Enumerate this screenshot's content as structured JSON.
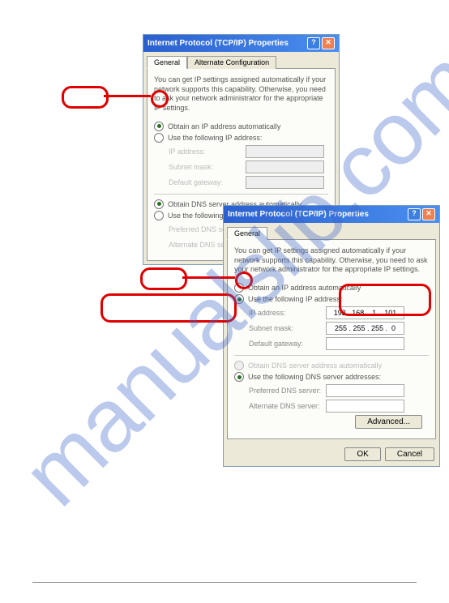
{
  "dialog": {
    "title": "Internet Protocol (TCP/IP) Properties",
    "tabs": {
      "general": "General",
      "alt": "Alternate Configuration"
    },
    "desc": "You can get IP settings assigned automatically if your network supports this capability. Otherwise, you need to ask your network administrator for the appropriate IP settings.",
    "radio_auto_ip": "Obtain an IP address automatically",
    "radio_use_ip": "Use the following IP address:",
    "label_ip": "IP address:",
    "label_mask": "Subnet mask:",
    "label_gw": "Default gateway:",
    "radio_auto_dns": "Obtain DNS server address automatically",
    "radio_use_dns": "Use the following DNS server addresses:",
    "label_pdns": "Preferred DNS server:",
    "label_adns": "Alternate DNS server:",
    "btn_adv": "Advanced...",
    "btn_ok": "OK",
    "btn_cancel": "Cancel"
  },
  "values2": {
    "ip": "192 . 168 .  1  . 101",
    "mask": "255 . 255 . 255 .  0",
    "gw": ""
  }
}
